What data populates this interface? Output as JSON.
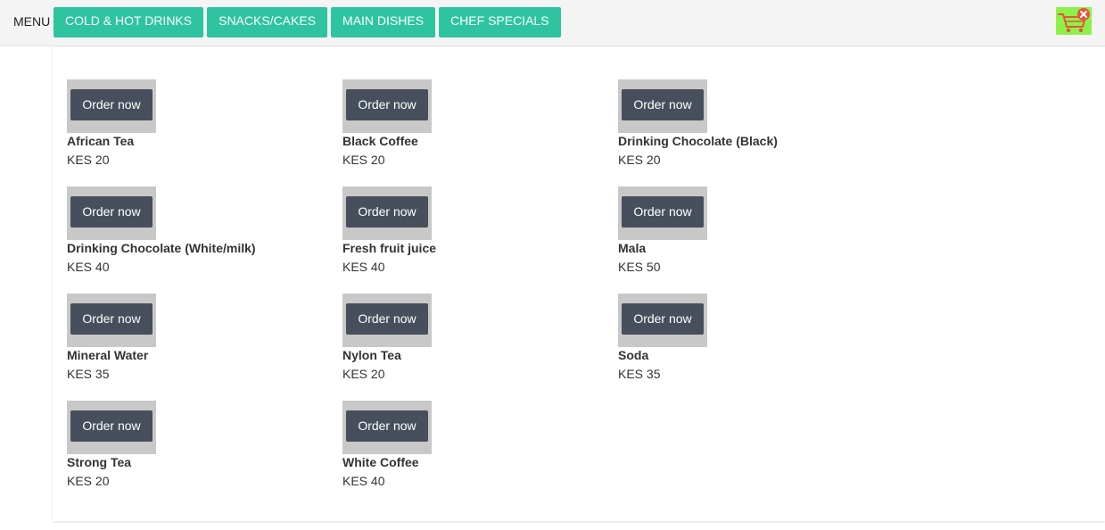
{
  "header": {
    "menu_label": "MENU",
    "tabs": [
      {
        "label": "COLD & HOT DRINKS"
      },
      {
        "label": "SNACKS/CAKES"
      },
      {
        "label": "MAIN DISHES"
      },
      {
        "label": "CHEF SPECIALS"
      }
    ],
    "cart_icon": "shopping-cart-icon",
    "cart_badge_icon": "close-x-icon",
    "accent_color": "#2ec4a0",
    "cart_bg_color": "#8cf24a"
  },
  "order_button_label": "Order now",
  "items": [
    {
      "name": "African Tea",
      "price": "KES 20"
    },
    {
      "name": "Black Coffee",
      "price": "KES 20"
    },
    {
      "name": "Drinking Chocolate (Black)",
      "price": "KES 20"
    },
    {
      "name": "Drinking Chocolate (White/milk)",
      "price": "KES 40"
    },
    {
      "name": "Fresh fruit juice",
      "price": "KES 40"
    },
    {
      "name": "Mala",
      "price": "KES 50"
    },
    {
      "name": "Mineral Water",
      "price": "KES 35"
    },
    {
      "name": "Nylon Tea",
      "price": "KES 20"
    },
    {
      "name": "Soda",
      "price": "KES 35"
    },
    {
      "name": "Strong Tea",
      "price": "KES 20"
    },
    {
      "name": "White Coffee",
      "price": "KES 40"
    }
  ]
}
